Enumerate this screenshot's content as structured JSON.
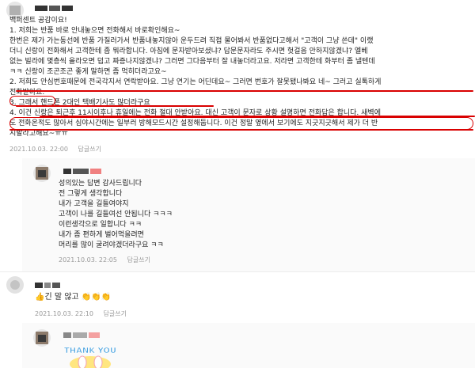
{
  "comment1": {
    "lines": [
      "백퍼센트 공감이요!",
      "1. 저희는 반품 바로 안내놓으면 전화해서 바로확인해요~",
      "한번은 제가 가는동선에 반품 가질러가서 반품내놓지않아 운두드려 직접 물어봐서 반품없다고해서 \"고객이 그냥 쓴데\" 이랬",
      "더니 신랑이 전화해서 고객한테 좀 뭐라합니다. 아침에 문자받아보셨냐? 답문문자라도 주시면 헛걸음 안하지않겠냐? 엘베",
      "없는 빌라에 몇층씩 올라오면 덥고 짜증나지않겠냐? 그러면 그다음부터 잘 내놓더라고요. 저라면 고객한테 화부터 좀 낼텐데",
      "ㅋㅋ 신랑이 조곤조곤 좋게 말하면 좀 먹히더라고요~",
      "2. 저희도 안심번호때문에 전국각지서 연락받아요. 그냥 연기는 어딘데요~ 그러면 번호가 잘못됐나봐요 네~ 그러고 실톡하게",
      "전화받아요.",
      "3. 그래서 핸드폰 2대인 택배기사도 많더라구요",
      "4. 이건 신랑은 퇴근후 11시이후나 휴일에는 전화 절대 안받아요. 대신 고객이 문자로 상황 설명하면 전화답은 합니다. 새벽에",
      "도 전화온적도 많아서 심야시간에는 일부러 방해모드시간 설정해둡니다. 이건 정말 옆에서 보기에도 지긋지긋해서 제가 더 반",
      "시발라고해요~ㅠㅠ"
    ],
    "date": "2021.10.03. 22:00",
    "reply_label": "답글쓰기"
  },
  "reply1": {
    "lines": [
      "성의있는 답변 감사드립니다",
      "전 그렇게 생각합니다",
      "내가 고객을 길들여야지",
      "고객이 나를 길들여선 안됩니다 ㅋㅋㅋ",
      "이런생각으로 일합니다 ㅋㅋ",
      "내가 좀 편하게 벌어먹을려면",
      "머리를 많이 굴려야겠더라구요 ㅋㅋ"
    ],
    "date": "2021.10.03. 22:05",
    "reply_label": "답글쓰기"
  },
  "comment2": {
    "text": "👍긴 말 않고 👏👏👏",
    "date": "2021.10.03. 22:10",
    "reply_label": "답글쓰기"
  },
  "sticker": {
    "text": "THANK YOU"
  },
  "colors": {
    "annotation_red": "#d90000",
    "meta_gray": "#999999",
    "reply_bg": "#fafafa"
  }
}
